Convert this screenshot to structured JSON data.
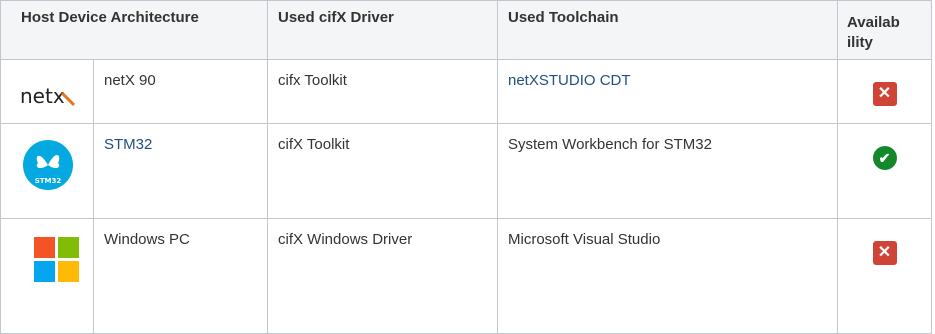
{
  "table": {
    "headers": {
      "host": "Host Device Architecture",
      "driver": "Used cifX Driver",
      "toolchain": "Used Toolchain",
      "availability": "Availab ility"
    },
    "rows": [
      {
        "logo_icon": "netx-logo-icon",
        "logo_text": "netx",
        "device": "netX 90",
        "driver": "cifx Toolkit",
        "toolchain": "netXSTUDIO CDT",
        "availability": "unavailable"
      },
      {
        "logo_icon": "stm32-logo-icon",
        "logo_text": "STM32",
        "device": "STM32",
        "driver": "cifX Toolkit",
        "toolchain": "System Workbench for STM32",
        "availability": "available"
      },
      {
        "logo_icon": "windows-logo-icon",
        "device": "Windows PC",
        "driver": "cifX Windows Driver",
        "toolchain": "Microsoft Visual Studio",
        "availability": "unavailable"
      }
    ]
  },
  "colors": {
    "link": "#205081",
    "header_bg": "#f4f5f7",
    "border": "#c1c7d0",
    "unavailable": "#d04437",
    "available": "#14892c",
    "netx_orange": "#e8731a",
    "stm32_blue": "#03a9e0",
    "windows_red": "#f35325",
    "windows_green": "#81bc06",
    "windows_blue": "#05a6f0",
    "windows_yellow": "#ffba08"
  },
  "status_glyphs": {
    "unavailable": "✕",
    "available": "✔"
  }
}
